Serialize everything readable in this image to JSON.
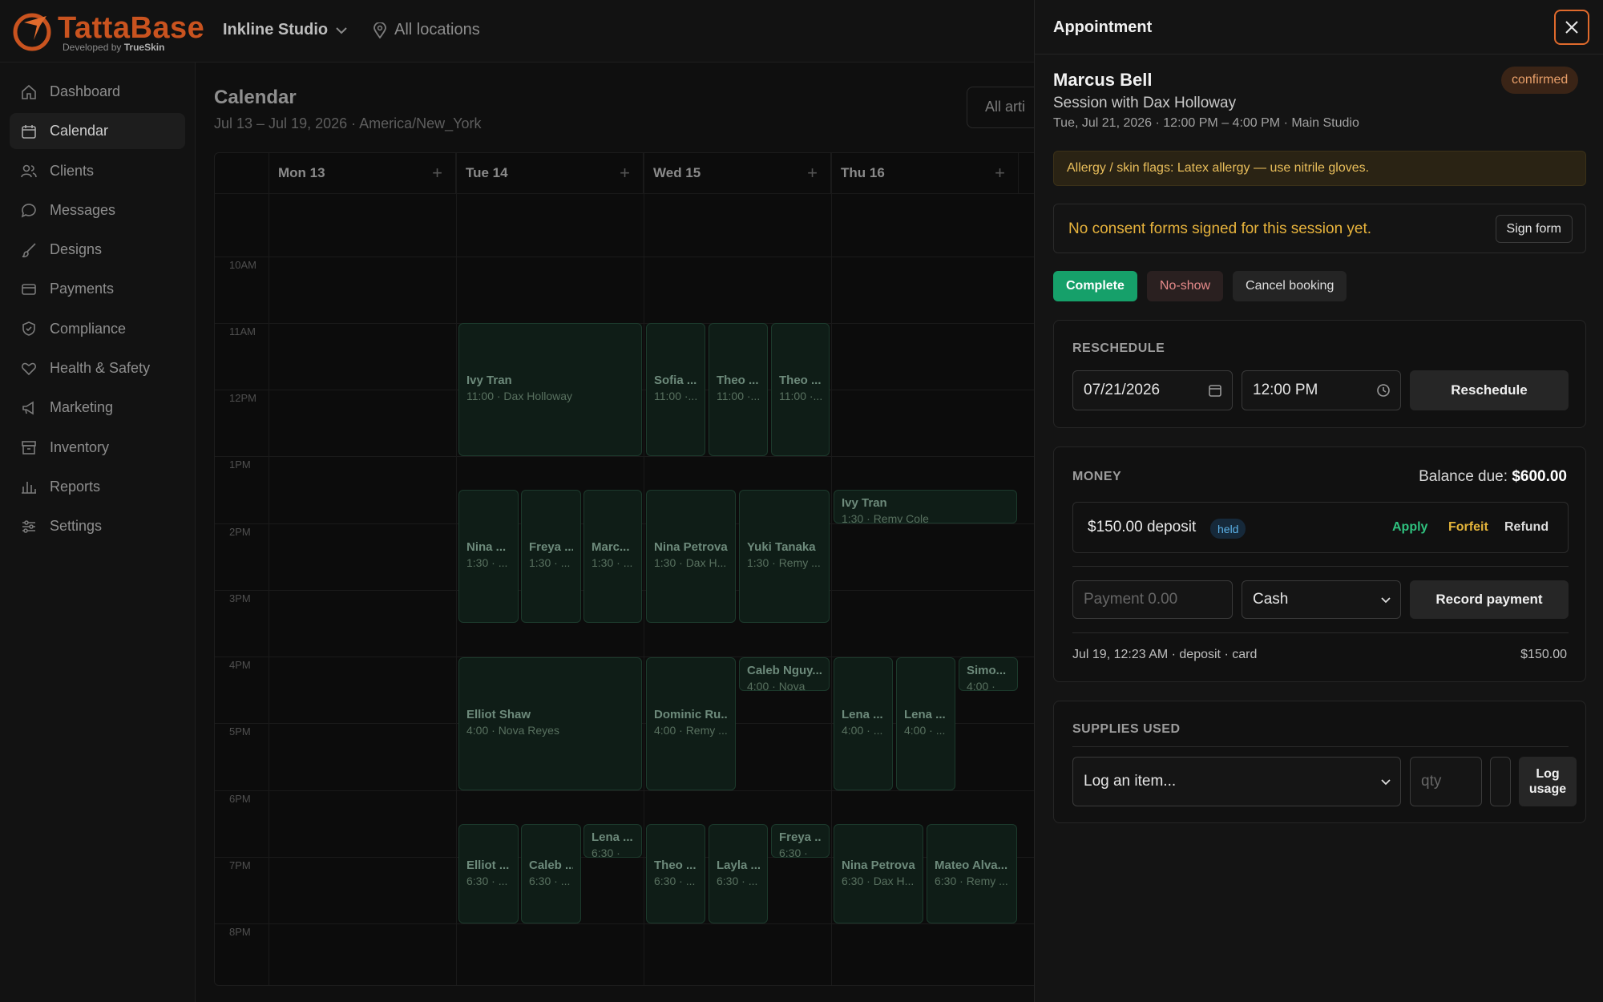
{
  "brand": {
    "name": "TattaBase",
    "sub_prefix": "Developed by",
    "sub_brand": "TrueSkin"
  },
  "topbar": {
    "studio": "Inkline Studio",
    "locations": "All locations"
  },
  "sidebar": {
    "items": [
      {
        "label": "Dashboard",
        "icon": "home-icon"
      },
      {
        "label": "Calendar",
        "icon": "calendar-icon",
        "active": true
      },
      {
        "label": "Clients",
        "icon": "users-icon"
      },
      {
        "label": "Messages",
        "icon": "message-icon"
      },
      {
        "label": "Designs",
        "icon": "brush-icon"
      },
      {
        "label": "Payments",
        "icon": "card-icon"
      },
      {
        "label": "Compliance",
        "icon": "shield-icon"
      },
      {
        "label": "Health & Safety",
        "icon": "heart-icon"
      },
      {
        "label": "Marketing",
        "icon": "megaphone-icon"
      },
      {
        "label": "Inventory",
        "icon": "box-icon"
      },
      {
        "label": "Reports",
        "icon": "chart-icon"
      },
      {
        "label": "Settings",
        "icon": "sliders-icon"
      }
    ]
  },
  "calendar": {
    "title": "Calendar",
    "range": "Jul 13 – Jul 19, 2026 · America/New_York",
    "artist_filter": "All arti",
    "days": [
      "Mon 13",
      "Tue 14",
      "Wed 15",
      "Thu 16"
    ],
    "hours": [
      "10AM",
      "11AM",
      "12PM",
      "1PM",
      "2PM",
      "3PM",
      "4PM",
      "5PM",
      "6PM",
      "7PM",
      "8PM"
    ],
    "appointments": [
      {
        "name": "Ivy Tran",
        "time": "11:00 · Dax Holloway"
      },
      {
        "name": "Sofia ...",
        "time": "11:00 ·..."
      },
      {
        "name": "Theo ...",
        "time": "11:00 ·..."
      },
      {
        "name": "Theo ...",
        "time": "11:00 ·..."
      },
      {
        "name": "Nina ...",
        "time": "1:30 · ..."
      },
      {
        "name": "Freya ...",
        "time": "1:30 · ..."
      },
      {
        "name": "Marc...",
        "time": "1:30 · ..."
      },
      {
        "name": "Nina Petrova",
        "time": "1:30 · Dax H..."
      },
      {
        "name": "Yuki Tanaka",
        "time": "1:30 · Remy ..."
      },
      {
        "name": "Ivy Tran",
        "time": "1:30 · Remy Cole"
      },
      {
        "name": "Elliot Shaw",
        "time": "4:00 · Nova Reyes"
      },
      {
        "name": "Dominic Ru...",
        "time": "4:00 · Remy ..."
      },
      {
        "name": "Caleb Nguy...",
        "time": "4:00 · Nova"
      },
      {
        "name": "Lena ...",
        "time": "4:00 · ..."
      },
      {
        "name": "Lena ...",
        "time": "4:00 · ..."
      },
      {
        "name": "Simo...",
        "time": "4:00 ·"
      },
      {
        "name": "Elliot ...",
        "time": "6:30 · ..."
      },
      {
        "name": "Caleb ...",
        "time": "6:30 · ..."
      },
      {
        "name": "Lena ...",
        "time": "6:30 ·"
      },
      {
        "name": "Theo ...",
        "time": "6:30 · ..."
      },
      {
        "name": "Layla ...",
        "time": "6:30 · ..."
      },
      {
        "name": "Freya ...",
        "time": "6:30 ·"
      },
      {
        "name": "Nina Petrova",
        "time": "6:30 · Dax H..."
      },
      {
        "name": "Mateo Alva...",
        "time": "6:30 · Remy ..."
      }
    ]
  },
  "drawer": {
    "title": "Appointment",
    "client": "Marcus Bell",
    "status": "confirmed",
    "session": "Session with Dax Holloway",
    "when": "Tue, Jul 21, 2026 · 12:00 PM – 4:00 PM · Main Studio",
    "allergy": "Allergy / skin flags: Latex allergy — use nitrile gloves.",
    "consent_text": "No consent forms signed for this session yet.",
    "sign_label": "Sign form",
    "actions": {
      "complete": "Complete",
      "noshow": "No-show",
      "cancel": "Cancel booking"
    },
    "reschedule": {
      "label": "RESCHEDULE",
      "date": "07/21/2026",
      "time": "12:00 PM",
      "button": "Reschedule"
    },
    "money": {
      "label": "MONEY",
      "balance_label": "Balance due:",
      "balance_value": "$600.00",
      "deposit": "$150.00 deposit",
      "deposit_status": "held",
      "apply": "Apply",
      "forfeit": "Forfeit",
      "refund": "Refund",
      "payment_placeholder": "Payment 0.00",
      "method": "Cash",
      "record": "Record payment",
      "history_desc": "Jul 19, 12:23 AM · deposit · card",
      "history_amount": "$150.00"
    },
    "supplies": {
      "label": "SUPPLIES USED",
      "select": "Log an item...",
      "qty_placeholder": "qty",
      "log_line1": "Log",
      "log_line2": "usage"
    }
  },
  "colors": {
    "accent": "#e06a2c",
    "success": "#16a06a",
    "warning": "#e7b33c",
    "appointment_bg": "#0f1d17"
  }
}
